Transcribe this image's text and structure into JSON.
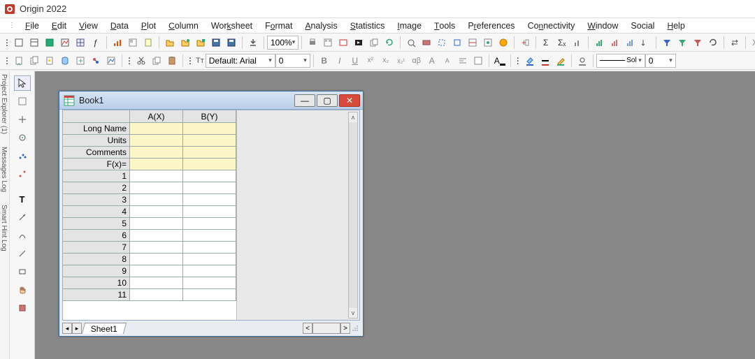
{
  "app": {
    "title": "Origin 2022"
  },
  "menu": {
    "items": [
      "File",
      "Edit",
      "View",
      "Data",
      "Plot",
      "Column",
      "Worksheet",
      "Format",
      "Analysis",
      "Statistics",
      "Image",
      "Tools",
      "Preferences",
      "Connectivity",
      "Window",
      "Social",
      "Help"
    ],
    "accel": [
      0,
      0,
      0,
      0,
      0,
      0,
      0,
      0,
      0,
      0,
      0,
      0,
      0,
      2,
      0,
      0,
      0
    ]
  },
  "toolbar": {
    "zoom": "100%",
    "font": "Default: Arial",
    "fontprefix": "Tᴛ",
    "fontsize": "0",
    "linestyle": "Sol",
    "linesize": "0"
  },
  "sidebar_labels": [
    "Project Explorer (1)",
    "Messages Log",
    "Smart Hint Log"
  ],
  "workbook": {
    "title": "Book1",
    "columns": [
      "A(X)",
      "B(Y)"
    ],
    "meta_rows": [
      "Long Name",
      "Units",
      "Comments",
      "F(x)="
    ],
    "num_rows": [
      1,
      2,
      3,
      4,
      5,
      6,
      7,
      8,
      9,
      10,
      11
    ],
    "sheet": "Sheet1",
    "nav": {
      "prev": "◂",
      "next": "▸",
      "hprev": "<",
      "hnext": ">"
    },
    "scroll": {
      "up": "ʌ",
      "down": "v"
    },
    "controls": {
      "min": "—",
      "max": "▢",
      "close": "✕"
    }
  }
}
